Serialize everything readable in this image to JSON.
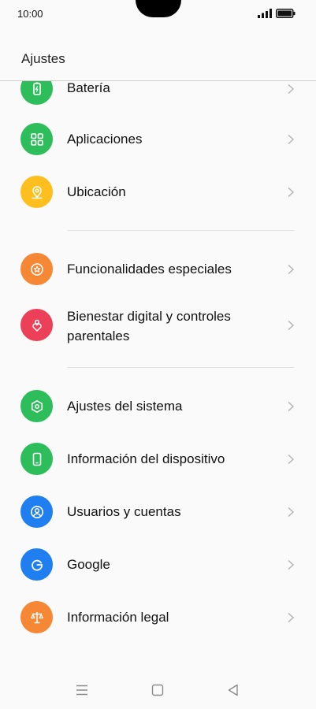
{
  "status_bar": {
    "time": "10:00"
  },
  "header": {
    "title": "Ajustes"
  },
  "colors": {
    "green": "#2dbd5a",
    "yellow": "#fcbf1e",
    "orange": "#f68735",
    "red": "#ec4058",
    "blue": "#1f7ff0"
  },
  "items": [
    {
      "label": "Batería",
      "icon": "battery-icon",
      "color": "green"
    },
    {
      "label": "Aplicaciones",
      "icon": "apps-grid-icon",
      "color": "green"
    },
    {
      "label": "Ubicación",
      "icon": "location-pin-icon",
      "color": "yellow"
    },
    {
      "label": "Funcionalidades especiales",
      "icon": "star-badge-icon",
      "color": "orange"
    },
    {
      "label": "Bienestar digital y controles",
      "label_line2": "parentales",
      "icon": "heart-person-icon",
      "color": "red"
    },
    {
      "label": "Ajustes del sistema",
      "icon": "hexagon-gear-icon",
      "color": "green"
    },
    {
      "label": "Información del dispositivo",
      "icon": "phone-icon",
      "color": "green"
    },
    {
      "label": "Usuarios y cuentas",
      "icon": "user-circle-icon",
      "color": "blue"
    },
    {
      "label": "Google",
      "icon": "google-g-icon",
      "color": "blue"
    },
    {
      "label": "Información legal",
      "icon": "scales-icon",
      "color": "orange"
    }
  ]
}
